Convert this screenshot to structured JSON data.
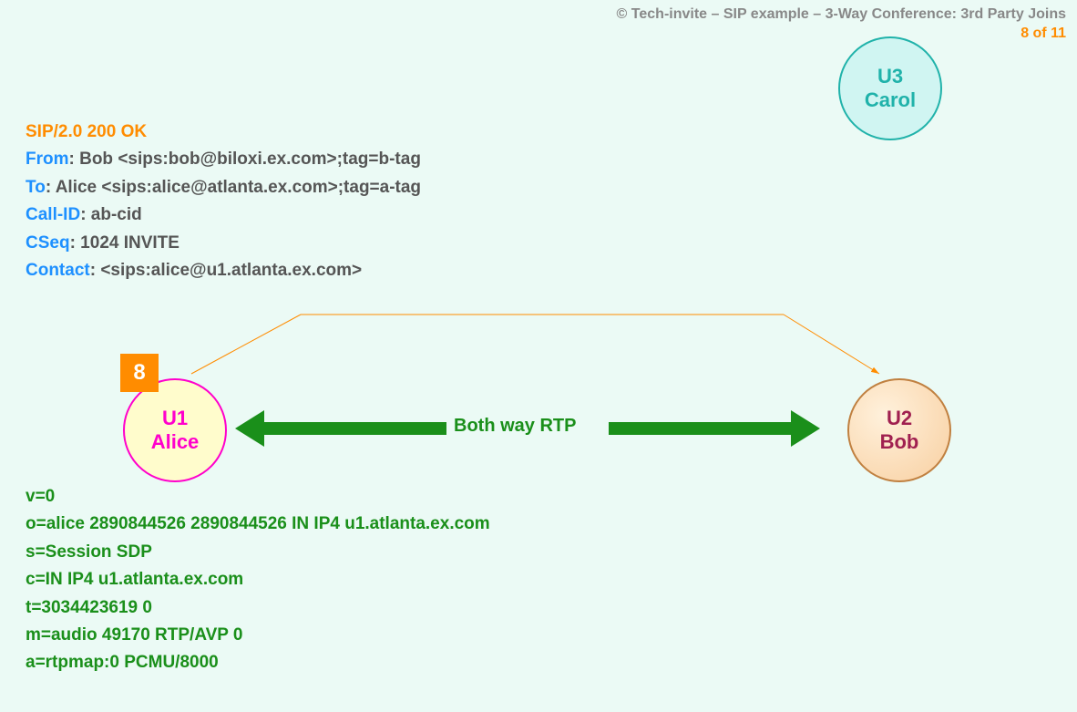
{
  "header": {
    "copyright": "© Tech-invite – SIP example – 3-Way Conference: 3rd Party Joins",
    "page": "8 of 11"
  },
  "sip": {
    "status": "SIP/2.0 200 OK",
    "from_name": "From",
    "from_val": ": Bob <sips:bob@biloxi.ex.com>;tag=b-tag",
    "to_name": "To",
    "to_val": ": Alice <sips:alice@atlanta.ex.com>;tag=a-tag",
    "callid_name": "Call-ID",
    "callid_val": ": ab-cid",
    "cseq_name": "CSeq",
    "cseq_val": ": 1024 INVITE",
    "contact_name": "Contact",
    "contact_val": ": <sips:alice@u1.atlanta.ex.com>"
  },
  "sdp": {
    "l1": "v=0",
    "l2": "o=alice  2890844526  2890844526  IN  IP4  u1.atlanta.ex.com",
    "l3": "s=Session SDP",
    "l4": "c=IN  IP4  u1.atlanta.ex.com",
    "l5": "t=3034423619  0",
    "l6": "m=audio  49170  RTP/AVP  0",
    "l7": "a=rtpmap:0  PCMU/8000"
  },
  "nodes": {
    "alice_id": "U1",
    "alice_name": "Alice",
    "bob_id": "U2",
    "bob_name": "Bob",
    "carol_id": "U3",
    "carol_name": "Carol"
  },
  "step": "8",
  "rtp_label": "Both way RTP"
}
